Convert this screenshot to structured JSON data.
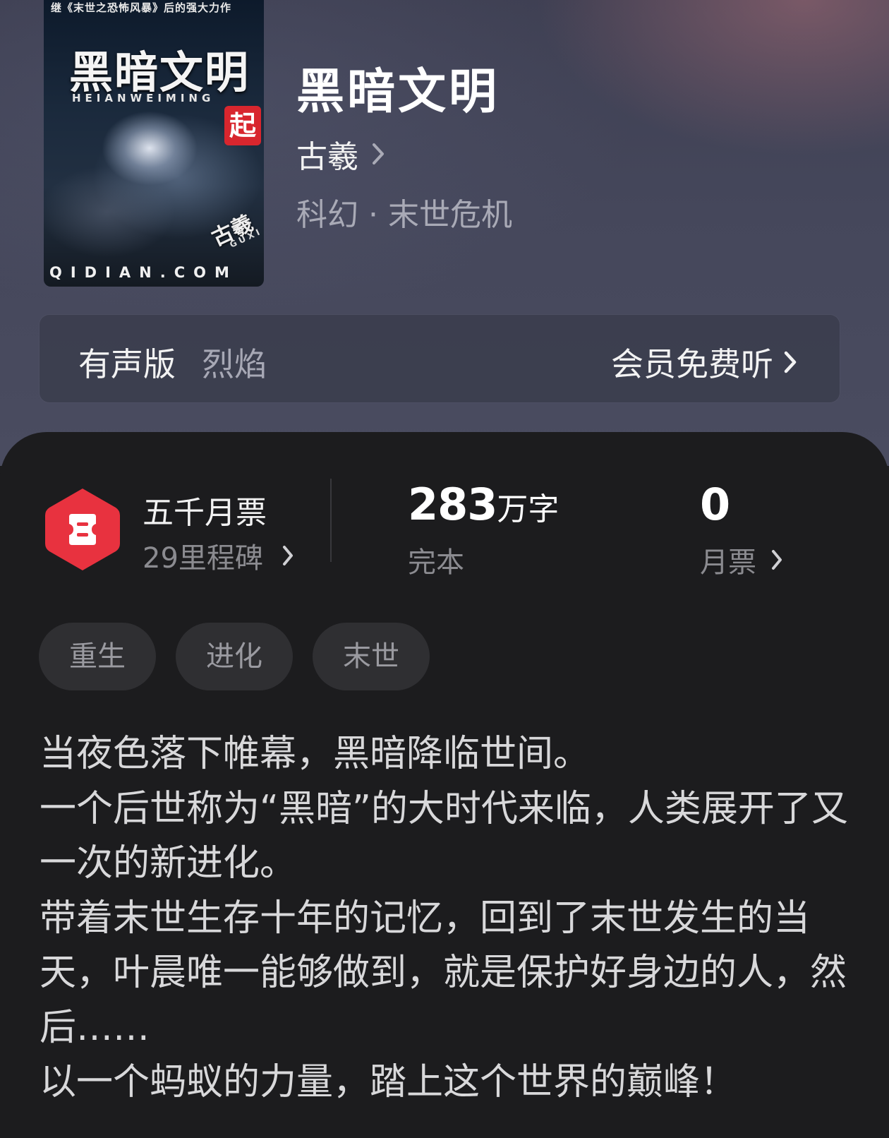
{
  "cover": {
    "top_text": "继《末世之恐怖风暴》后的强大力作",
    "title": "黑暗文明",
    "pinyin": "HEIANWEIMING",
    "badge": "起",
    "author": "古羲",
    "author_pinyin": "GUXI",
    "site": "QIDIAN.COM"
  },
  "book": {
    "title": "黑暗文明",
    "author": "古羲",
    "genre": "科幻 · 末世危机"
  },
  "audio": {
    "label": "有声版",
    "narrator": "烈焰",
    "cta": "会员免费听"
  },
  "stats": {
    "ticket_title": "五千月票",
    "milestones": "29里程碑",
    "word_count": "283",
    "word_unit": "万字",
    "status": "完本",
    "monthly_votes": "0",
    "votes_label": "月票"
  },
  "tags": [
    "重生",
    "进化",
    "末世"
  ],
  "description": [
    "当夜色落下帷幕，黑暗降临世间。",
    "一个后世称为“黑暗”的大时代来临，人类展开了又一次的新进化。",
    "带着末世生存十年的记忆，回到了末世发生的当天，叶晨唯一能够做到，就是保护好身边的人，然后……",
    "以一个蚂蚁的力量，踏上这个世界的巅峰！"
  ],
  "colors": {
    "ticket_icon": "#e8323f",
    "panel_bg": "#1c1c1e",
    "header_bg": "#45475b"
  }
}
